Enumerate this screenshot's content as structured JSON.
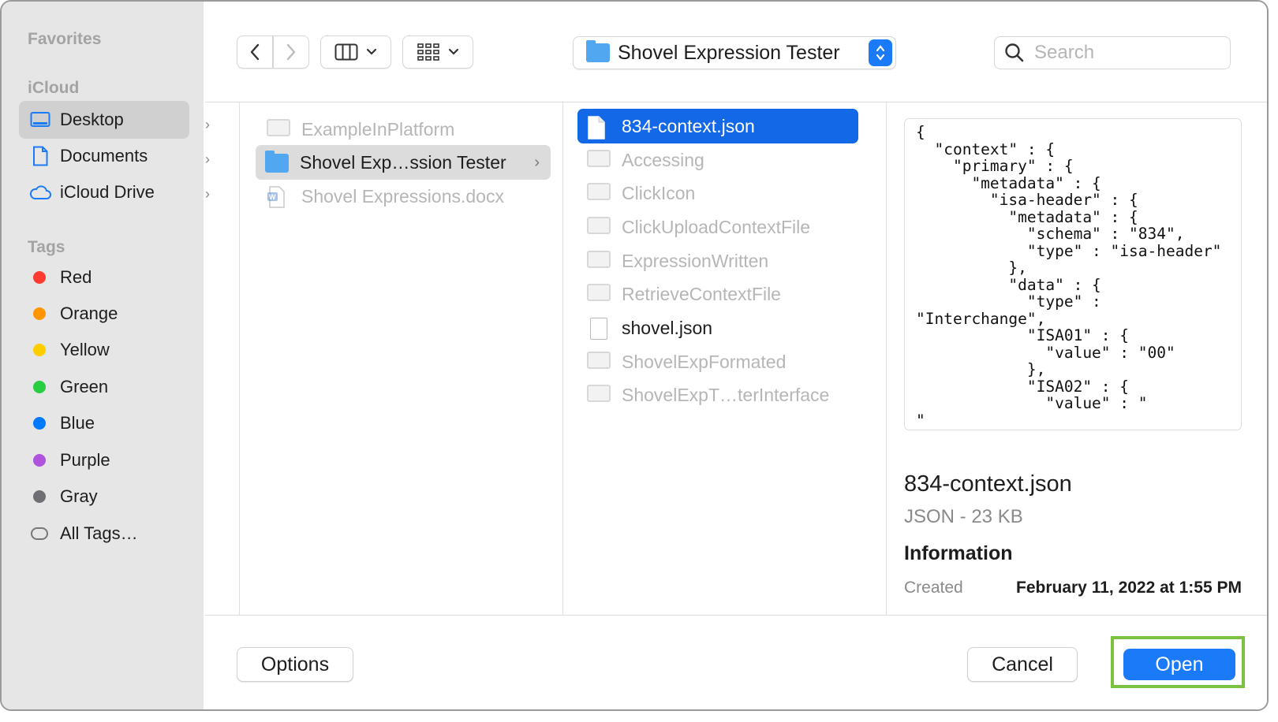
{
  "sidebar": {
    "favorites_header": "Favorites",
    "icloud_header": "iCloud",
    "icloud_items": [
      {
        "label": "Desktop",
        "icon": "desktop-icon",
        "selected": true
      },
      {
        "label": "Documents",
        "icon": "document-icon"
      },
      {
        "label": "iCloud Drive",
        "icon": "cloud-icon"
      }
    ],
    "tags_header": "Tags",
    "tags": [
      {
        "label": "Red",
        "color": "#ff3b30"
      },
      {
        "label": "Orange",
        "color": "#ff9500"
      },
      {
        "label": "Yellow",
        "color": "#ffcc00"
      },
      {
        "label": "Green",
        "color": "#28cd41"
      },
      {
        "label": "Blue",
        "color": "#007aff"
      },
      {
        "label": "Purple",
        "color": "#af52de"
      },
      {
        "label": "Gray",
        "color": "#6e6e73"
      },
      {
        "label": "All Tags…",
        "color": null
      }
    ]
  },
  "toolbar": {
    "location": "Shovel Expression Tester",
    "search_placeholder": "Search"
  },
  "column_b": [
    {
      "label": "ExampleInPlatform",
      "icon": "app-icon",
      "dim": true
    },
    {
      "label": "Shovel Exp…ssion Tester",
      "icon": "folder-icon",
      "selected": true
    },
    {
      "label": "Shovel Expressions.docx",
      "icon": "word-doc-icon",
      "dim": true
    }
  ],
  "column_c": [
    {
      "label": "834-context.json",
      "icon": "json-file-icon",
      "selected": true
    },
    {
      "label": "Accessing",
      "icon": "app-icon",
      "dim": true
    },
    {
      "label": "ClickIcon",
      "icon": "app-icon",
      "dim": true
    },
    {
      "label": "ClickUploadContextFile",
      "icon": "app-icon",
      "dim": true
    },
    {
      "label": "ExpressionWritten",
      "icon": "app-icon",
      "dim": true
    },
    {
      "label": "RetrieveContextFile",
      "icon": "app-icon",
      "dim": true
    },
    {
      "label": "shovel.json",
      "icon": "json-file-icon",
      "dim": false
    },
    {
      "label": "ShovelExpFormated",
      "icon": "app-icon",
      "dim": true
    },
    {
      "label": "ShovelExpT…terInterface",
      "icon": "app-icon",
      "dim": true
    }
  ],
  "preview": {
    "code": "{\n  \"context\" : {\n    \"primary\" : {\n      \"metadata\" : {\n        \"isa-header\" : {\n          \"metadata\" : {\n            \"schema\" : \"834\",\n            \"type\" : \"isa-header\"\n          },\n          \"data\" : {\n            \"type\" :\n\"Interchange\",\n            \"ISA01\" : {\n              \"value\" : \"00\"\n            },\n            \"ISA02\" : {\n              \"value\" : \"\n\"\n            }",
    "file_name": "834-context.json",
    "kind": "JSON - 23 KB",
    "info_header": "Information",
    "created_label": "Created",
    "created_value": "February 11, 2022 at 1:55 PM"
  },
  "footer": {
    "options_label": "Options",
    "cancel_label": "Cancel",
    "open_label": "Open"
  }
}
